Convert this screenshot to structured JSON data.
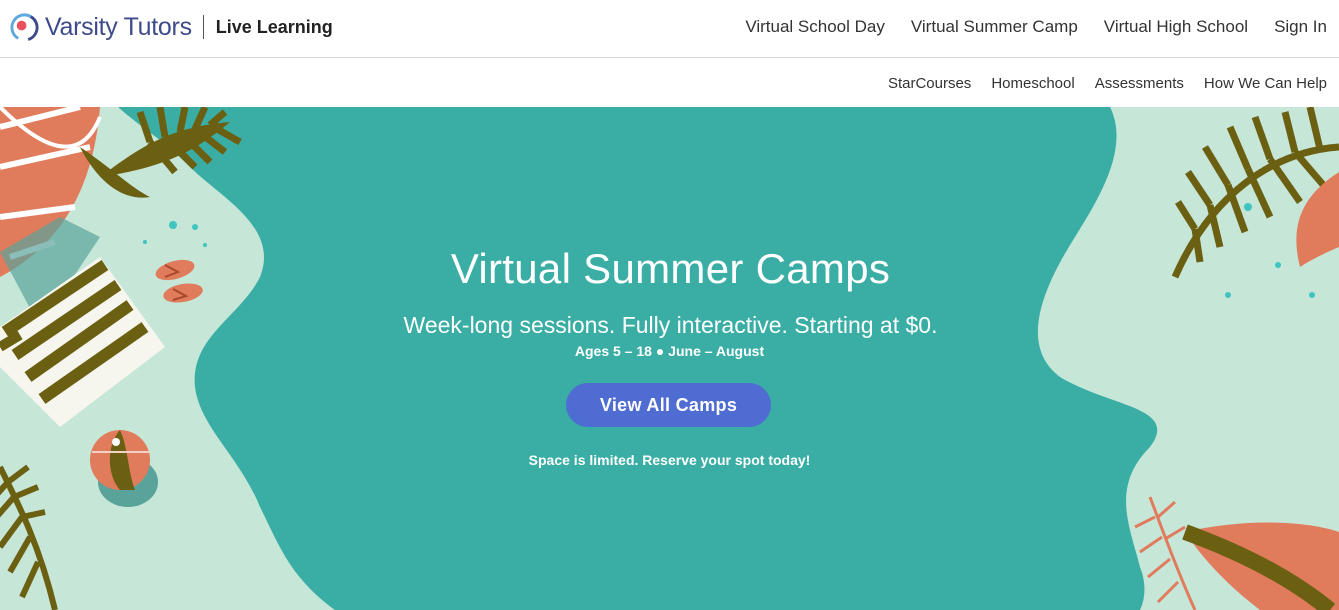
{
  "header": {
    "brand_name": "Varsity Tutors",
    "brand_sub": "Live Learning",
    "nav": [
      {
        "label": "Virtual School Day"
      },
      {
        "label": "Virtual Summer Camp"
      },
      {
        "label": "Virtual High School"
      },
      {
        "label": "Sign In"
      }
    ]
  },
  "subnav": [
    {
      "label": "StarCourses"
    },
    {
      "label": "Homeschool"
    },
    {
      "label": "Assessments"
    },
    {
      "label": "How We Can Help"
    }
  ],
  "hero": {
    "title": "Virtual Summer Camps",
    "subtitle": "Week-long sessions. Fully interactive. Starting at $0.",
    "meta": "Ages 5 – 18 ● June – August",
    "button_label": "View All Camps",
    "note": "Space is limited. Reserve your spot today!"
  },
  "colors": {
    "brand_blue": "#3f4a8a",
    "button": "#4f6cd2",
    "water": "#3aaea5",
    "sand": "#c6e6d8",
    "coral": "#e07c5c",
    "olive": "#6b5f12"
  },
  "icons": {
    "logo": "varsity-tutors-logo-icon"
  }
}
